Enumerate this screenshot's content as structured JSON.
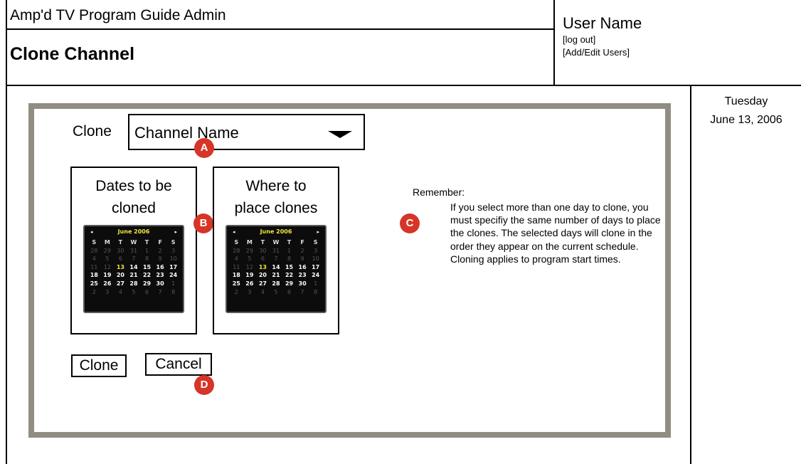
{
  "header": {
    "app_title": "Amp'd TV Program Guide Admin",
    "page_title": "Clone Channel",
    "user_name": "User Name",
    "logout_link": "[log out]",
    "add_edit_users_link": "[Add/Edit Users]"
  },
  "sidebar": {
    "day": "Tuesday",
    "date": "June 13, 2006"
  },
  "form": {
    "clone_label": "Clone",
    "channel_select_value": "Channel Name",
    "dates_heading_line1": "Dates to be",
    "dates_heading_line2": "cloned",
    "place_heading_line1": "Where to",
    "place_heading_line2": "place clones",
    "clone_button": "Clone",
    "cancel_button": "Cancel"
  },
  "calendar": {
    "month_label": "June 2006",
    "prev": "◂",
    "next": "▸",
    "dow": [
      "S",
      "M",
      "T",
      "W",
      "T",
      "F",
      "S"
    ],
    "weeks": [
      [
        "28",
        "29",
        "30",
        "31",
        "1",
        "2",
        "3"
      ],
      [
        "4",
        "5",
        "6",
        "7",
        "8",
        "9",
        "10"
      ],
      [
        "11",
        "12",
        "13",
        "14",
        "15",
        "16",
        "17"
      ],
      [
        "18",
        "19",
        "20",
        "21",
        "22",
        "23",
        "24"
      ],
      [
        "25",
        "26",
        "27",
        "28",
        "29",
        "30",
        "1"
      ],
      [
        "2",
        "3",
        "4",
        "5",
        "6",
        "7",
        "8"
      ]
    ],
    "muted": [
      [
        true,
        true,
        true,
        true,
        true,
        true,
        true
      ],
      [
        true,
        true,
        true,
        true,
        true,
        true,
        true
      ],
      [
        true,
        true,
        false,
        false,
        false,
        false,
        false
      ],
      [
        false,
        false,
        false,
        false,
        false,
        false,
        false
      ],
      [
        false,
        false,
        false,
        false,
        false,
        false,
        true
      ],
      [
        true,
        true,
        true,
        true,
        true,
        true,
        true
      ]
    ],
    "today": "13"
  },
  "notes": {
    "remember_label": "Remember:",
    "remember_text": "If you select more than one day to clone, you must specifiy the same number of days to place the clones. The selected days will clone in the order they appear on the current schedule.  Cloning applies to program start times."
  },
  "callouts": {
    "a": "A",
    "b": "B",
    "c": "C",
    "d": "D"
  },
  "colors": {
    "callout": "#d63527",
    "panel_border": "#918d83",
    "calendar_highlight": "#f0e63c"
  }
}
